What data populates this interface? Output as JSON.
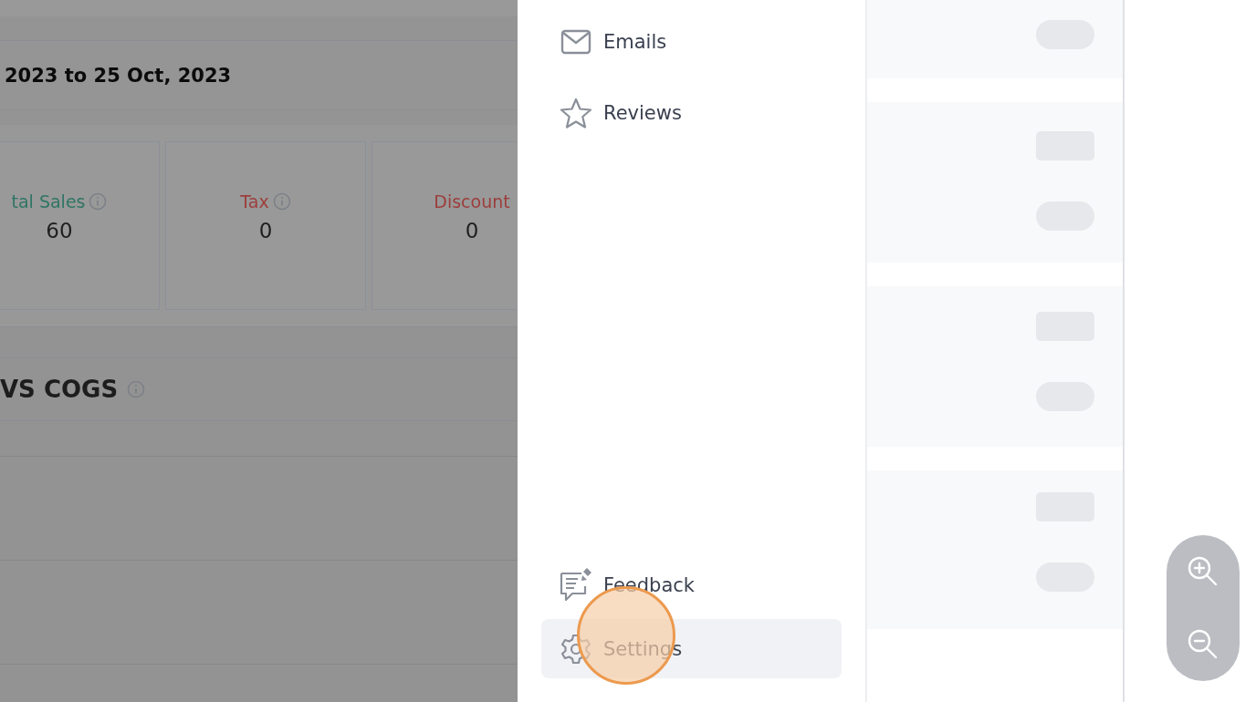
{
  "report": {
    "date_range": "2023 to 25 Oct, 2023",
    "stats": [
      {
        "label": "tal Sales",
        "value": "60",
        "color": "#2f7564",
        "info": true
      },
      {
        "label": "Tax",
        "value": "0",
        "color": "#9c3e3c",
        "info": true
      },
      {
        "label": "Discount",
        "value": "0",
        "color": "#9c3e3c",
        "info": false
      }
    ],
    "section_title": "VS COGS"
  },
  "menu": {
    "top_items": [
      {
        "label": "Emails",
        "selected": false
      },
      {
        "label": "Reviews",
        "selected": false
      }
    ],
    "bottom_items": [
      {
        "label": "Feedback",
        "selected": false
      },
      {
        "label": "Settings",
        "selected": true
      }
    ]
  }
}
